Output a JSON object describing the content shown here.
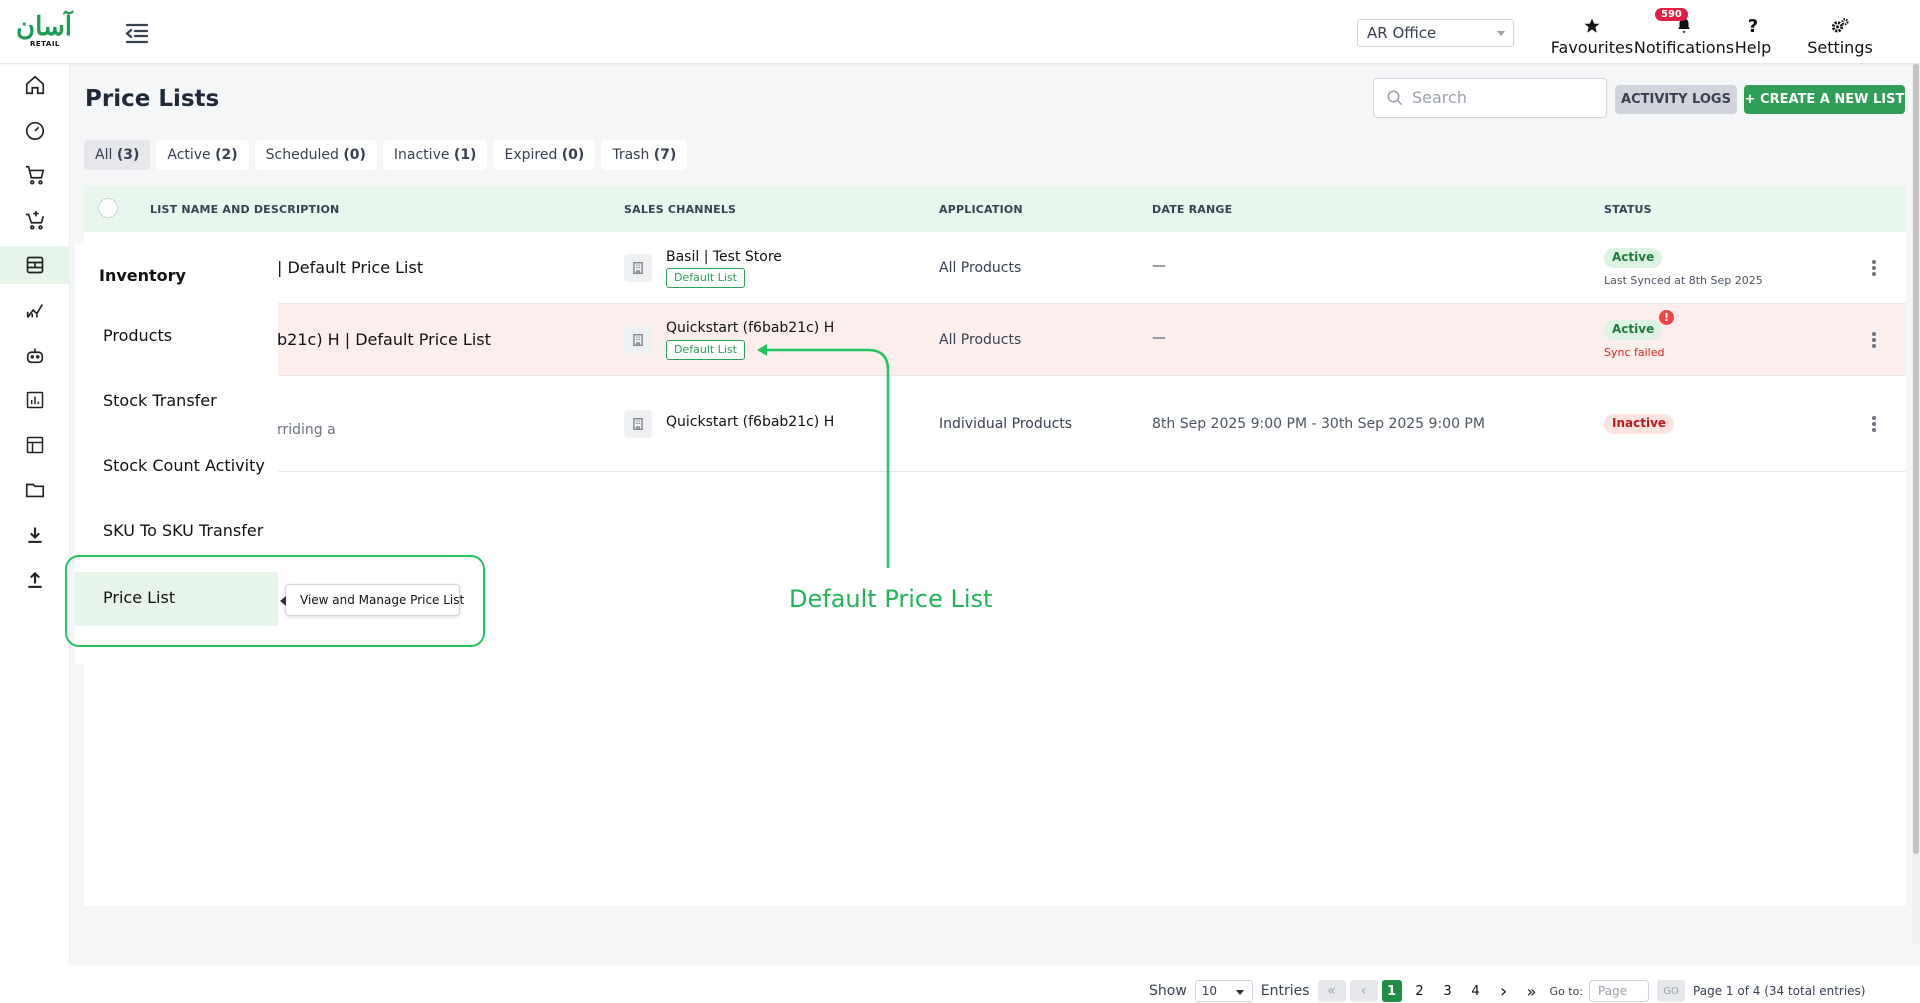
{
  "header": {
    "logo_ar": "آسان",
    "logo_en": "RETAIL",
    "office": "AR Office",
    "nav": [
      {
        "label": "Favourites",
        "icon": "star-icon"
      },
      {
        "label": "Notifications",
        "icon": "bell-icon",
        "badge": "590"
      },
      {
        "label": "Help",
        "icon": "question-icon"
      },
      {
        "label": "Settings",
        "icon": "gears-icon"
      }
    ]
  },
  "page": {
    "title": "Price Lists",
    "search_placeholder": "Search",
    "activity_logs": "ACTIVITY LOGS",
    "create_new": "+ CREATE A NEW LIST"
  },
  "filters": [
    {
      "label": "All",
      "count": "(3)"
    },
    {
      "label": "Active",
      "count": "(2)"
    },
    {
      "label": "Scheduled",
      "count": "(0)"
    },
    {
      "label": "Inactive",
      "count": "(1)"
    },
    {
      "label": "Expired",
      "count": "(0)"
    },
    {
      "label": "Trash",
      "count": "(7)"
    }
  ],
  "table": {
    "columns": [
      "LIST NAME AND DESCRIPTION",
      "SALES CHANNELS",
      "APPLICATION",
      "DATE RANGE",
      "STATUS"
    ],
    "rows": [
      {
        "name": "| Default Price List",
        "description": "",
        "channel": "Basil | Test Store",
        "tag": "Default List",
        "application": "All Products",
        "date_range": "—",
        "status": "Active",
        "status_sub": "Last Synced at 8th Sep 2025"
      },
      {
        "name": "b21c) H | Default Price List",
        "description": "",
        "channel": "Quickstart (f6bab21c) H",
        "tag": "Default List",
        "application": "All Products",
        "date_range": "—",
        "status": "Active",
        "status_sub": "Sync failed"
      },
      {
        "name": "",
        "description": "rriding a",
        "channel": "Quickstart (f6bab21c) H",
        "tag": "",
        "application": "Individual Products",
        "date_range": "8th Sep 2025 9:00 PM - 30th Sep 2025 9:00 PM",
        "status": "Inactive",
        "status_sub": ""
      }
    ]
  },
  "flyout": {
    "heading": "Inventory",
    "items": [
      "Products",
      "Stock Transfer",
      "Stock Count Activity",
      "SKU To SKU Transfer",
      "Price List"
    ],
    "tooltip": "View and Manage Price List"
  },
  "annotation": "Default Price List",
  "pagination": {
    "show_label": "Show",
    "page_size": "10",
    "entries_label": "Entries",
    "pages": [
      "1",
      "2",
      "3",
      "4"
    ],
    "goto_label": "Go to:",
    "goto_placeholder": "Page",
    "go": "GO",
    "summary": "Page 1 of 4 (34 total entries)"
  },
  "colors": {
    "brand": "#2f9e57",
    "annotation": "#22c55e",
    "error_bg": "#fdeeee"
  }
}
